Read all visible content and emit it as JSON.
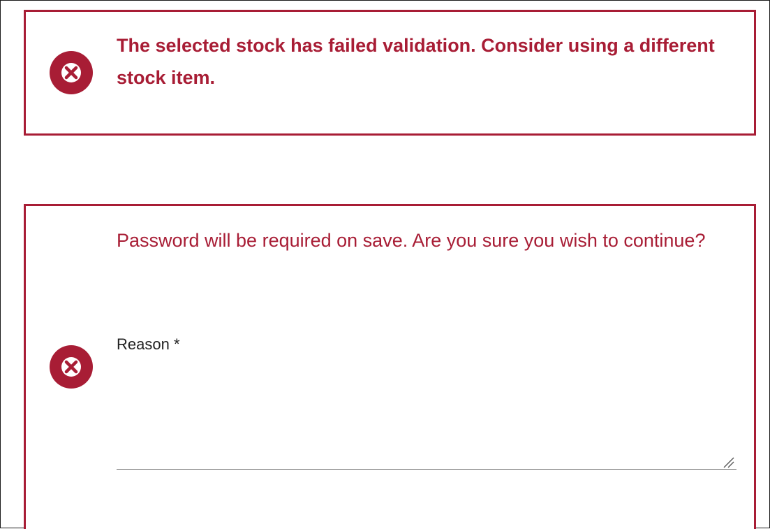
{
  "alerts": {
    "validation": {
      "icon": "error-circle-icon",
      "message": "The selected stock has failed validation. Consider using a different stock item."
    },
    "password": {
      "icon": "error-circle-icon",
      "message": "Password will be required on save. Are you sure you wish to continue?",
      "reason_label": "Reason *",
      "reason_value": ""
    }
  },
  "colors": {
    "error": "#a81d35",
    "label": "#222222"
  }
}
